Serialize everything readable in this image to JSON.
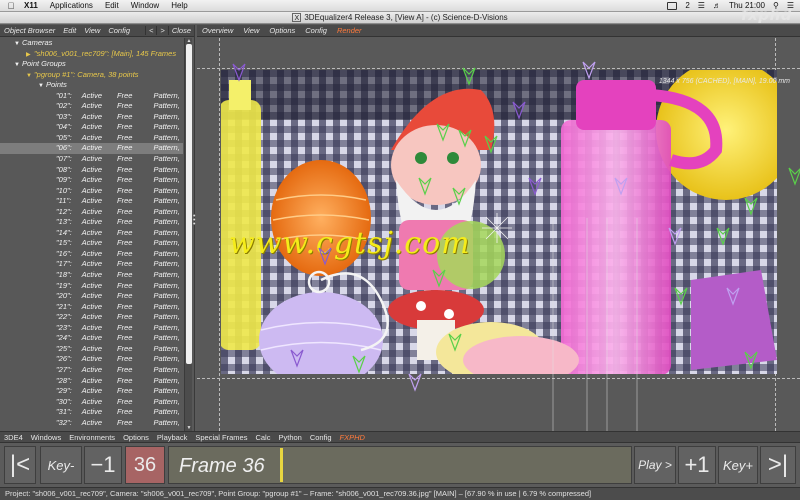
{
  "menubar": {
    "apple": "",
    "app_name": "X11",
    "items": [
      "Applications",
      "Edit",
      "Window",
      "Help"
    ],
    "battery_text": "2",
    "clock": "Thu 21:00"
  },
  "window": {
    "title": "3DEqualizer4 Release 3, [View A]  -  (c) Science-D-Visions",
    "x_badge": "X"
  },
  "logo": "fxphd",
  "object_browser": {
    "menu": [
      "Object Browser",
      "Edit",
      "View",
      "Config"
    ],
    "nav_prev": "<",
    "nav_next": ">",
    "nav_close": "Close",
    "cameras_label": "Cameras",
    "camera_entry": "\"sh006_v001_rec709\": [Main], 145 Frames",
    "point_groups_label": "Point Groups",
    "pgroup_entry": "\"pgroup #1\":  Camera, 38 points",
    "points_label": "Points",
    "selected_point": "\"06\":",
    "points": [
      {
        "name": "\"01\":",
        "status": "Active",
        "type": "Free",
        "mode": "Pattern,"
      },
      {
        "name": "\"02\":",
        "status": "Active",
        "type": "Free",
        "mode": "Pattern,"
      },
      {
        "name": "\"03\":",
        "status": "Active",
        "type": "Free",
        "mode": "Pattern,"
      },
      {
        "name": "\"04\":",
        "status": "Active",
        "type": "Free",
        "mode": "Pattern,"
      },
      {
        "name": "\"05\":",
        "status": "Active",
        "type": "Free",
        "mode": "Pattern,"
      },
      {
        "name": "\"06\":",
        "status": "Active",
        "type": "Free",
        "mode": "Pattern,"
      },
      {
        "name": "\"07\":",
        "status": "Active",
        "type": "Free",
        "mode": "Pattern,"
      },
      {
        "name": "\"08\":",
        "status": "Active",
        "type": "Free",
        "mode": "Pattern,"
      },
      {
        "name": "\"09\":",
        "status": "Active",
        "type": "Free",
        "mode": "Pattern,"
      },
      {
        "name": "\"10\":",
        "status": "Active",
        "type": "Free",
        "mode": "Pattern,"
      },
      {
        "name": "\"11\":",
        "status": "Active",
        "type": "Free",
        "mode": "Pattern,"
      },
      {
        "name": "\"12\":",
        "status": "Active",
        "type": "Free",
        "mode": "Pattern,"
      },
      {
        "name": "\"13\":",
        "status": "Active",
        "type": "Free",
        "mode": "Pattern,"
      },
      {
        "name": "\"14\":",
        "status": "Active",
        "type": "Free",
        "mode": "Pattern,"
      },
      {
        "name": "\"15\":",
        "status": "Active",
        "type": "Free",
        "mode": "Pattern,"
      },
      {
        "name": "\"16\":",
        "status": "Active",
        "type": "Free",
        "mode": "Pattern,"
      },
      {
        "name": "\"17\":",
        "status": "Active",
        "type": "Free",
        "mode": "Pattern,"
      },
      {
        "name": "\"18\":",
        "status": "Active",
        "type": "Free",
        "mode": "Pattern,"
      },
      {
        "name": "\"19\":",
        "status": "Active",
        "type": "Free",
        "mode": "Pattern,"
      },
      {
        "name": "\"20\":",
        "status": "Active",
        "type": "Free",
        "mode": "Pattern,"
      },
      {
        "name": "\"21\":",
        "status": "Active",
        "type": "Free",
        "mode": "Pattern,"
      },
      {
        "name": "\"22\":",
        "status": "Active",
        "type": "Free",
        "mode": "Pattern,"
      },
      {
        "name": "\"23\":",
        "status": "Active",
        "type": "Free",
        "mode": "Pattern,"
      },
      {
        "name": "\"24\":",
        "status": "Active",
        "type": "Free",
        "mode": "Pattern,"
      },
      {
        "name": "\"25\":",
        "status": "Active",
        "type": "Free",
        "mode": "Pattern,"
      },
      {
        "name": "\"26\":",
        "status": "Active",
        "type": "Free",
        "mode": "Pattern,"
      },
      {
        "name": "\"27\":",
        "status": "Active",
        "type": "Free",
        "mode": "Pattern,"
      },
      {
        "name": "\"28\":",
        "status": "Active",
        "type": "Free",
        "mode": "Pattern,"
      },
      {
        "name": "\"29\":",
        "status": "Active",
        "type": "Free",
        "mode": "Pattern,"
      },
      {
        "name": "\"30\":",
        "status": "Active",
        "type": "Free",
        "mode": "Pattern,"
      },
      {
        "name": "\"31\":",
        "status": "Active",
        "type": "Free",
        "mode": "Pattern,"
      },
      {
        "name": "\"32\":",
        "status": "Active",
        "type": "Free",
        "mode": "Pattern,"
      }
    ]
  },
  "viewport": {
    "menu": [
      "Overview",
      "View",
      "Options",
      "Config"
    ],
    "render_label": "Render",
    "info": "1344 x 756 (CACHED), [MAIN], 19.00 mm",
    "watermark": "www.cgtsj.com"
  },
  "bottom_menu": {
    "items": [
      "3DE4",
      "Windows",
      "Environments",
      "Options",
      "Playback",
      "Special Frames",
      "Calc",
      "Python",
      "Config"
    ],
    "fxphd": "FXPHD"
  },
  "timeline": {
    "first": "|<",
    "key_prev": "Key-",
    "minus1": "−1",
    "frame_number": "36",
    "frame_label": "Frame 36",
    "current_frame": 36,
    "total_frames": 145,
    "play": "Play >",
    "plus1": "+1",
    "key_next": "Key+",
    "last": ">|"
  },
  "status": "Project: \"sh006_v001_rec709\", Camera: \"sh006_v001_rec709\", Point Group: \"pgroup #1\"  –  Frame: \"sh006_v001_rec709.36.jpg\" [MAIN]  –  [67.90 % in use | 6.79 % compressed]",
  "colors": {
    "render_accent": "#ff7a3c",
    "camera_text": "#e8c84a",
    "frame_cell": "#a76464",
    "timeline_cursor": "#e8d640",
    "watermark": "#f5ec1a"
  }
}
